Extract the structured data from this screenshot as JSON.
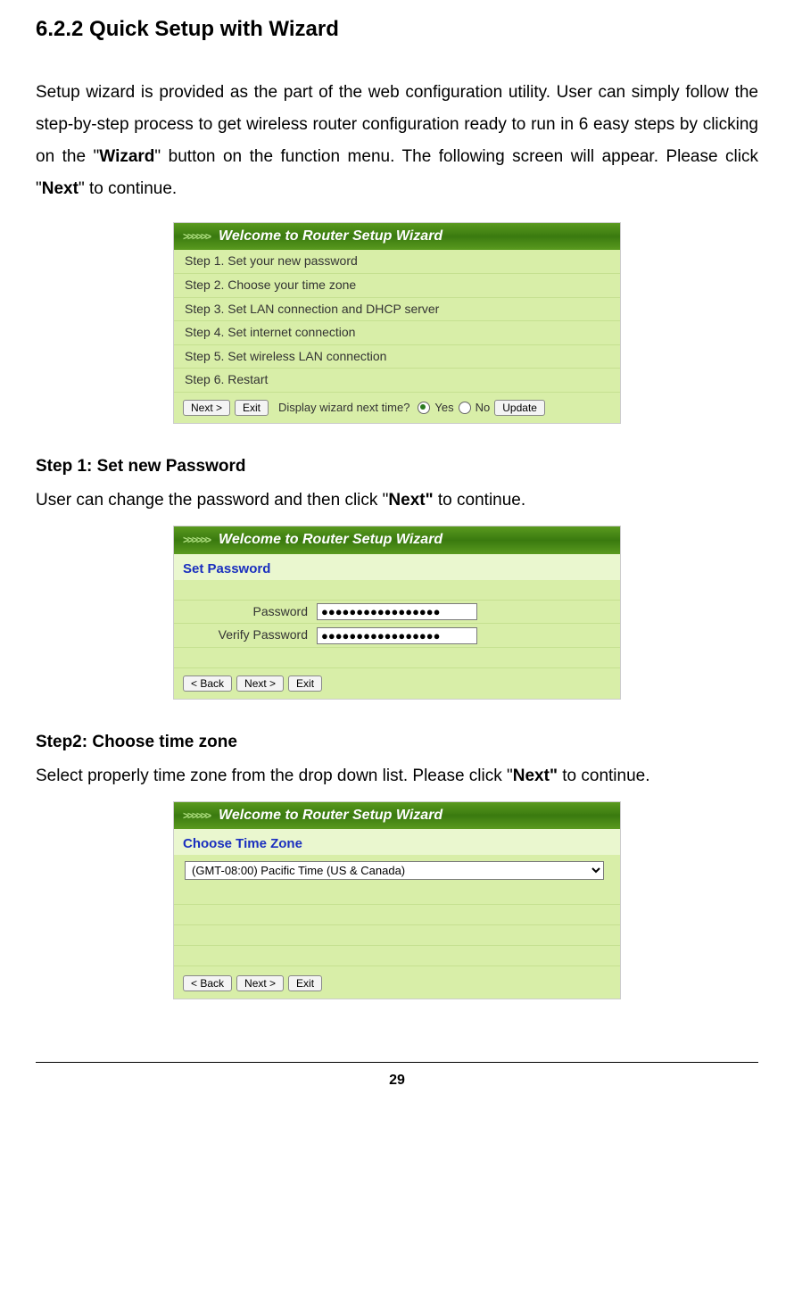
{
  "heading": "6.2.2    Quick Setup with Wizard",
  "intro_parts": {
    "p1": "Setup wizard is provided as the part of the web configuration utility. User can simply follow the step-by-step process to get wireless router configuration ready to run in 6 easy steps by clicking on the \"",
    "b1": "Wizard",
    "p2": "\" button on the function menu. The following screen will appear.    Please click \"",
    "b2": "Next",
    "p3": "\" to continue."
  },
  "wizard_header": "Welcome to Router Setup Wizard",
  "chevrons": ">>>>>>",
  "steps": [
    "Step 1. Set your new password",
    "Step 2. Choose your time zone",
    "Step 3. Set LAN connection and DHCP server",
    "Step 4. Set internet connection",
    "Step 5. Set wireless LAN connection",
    "Step 6. Restart"
  ],
  "buttons": {
    "next": "Next >",
    "exit": "Exit",
    "back": "< Back",
    "update": "Update"
  },
  "display_prompt": "Display wizard next time?",
  "yes": "Yes",
  "no": "No",
  "step1": {
    "title": "Step 1: Set new Password",
    "text_p1": "User can change the password and then click \"",
    "text_b": "Next\"",
    "text_p2": " to continue.",
    "section_label": "Set Password",
    "password_label": "Password",
    "verify_label": "Verify Password",
    "dots": "●●●●●●●●●●●●●●●●●"
  },
  "step2": {
    "title": "Step2: Choose time zone",
    "text_p1": "Select properly time zone from the drop down list.  Please click \"",
    "text_b": "Next\"",
    "text_p2": " to continue.",
    "section_label": "Choose Time Zone",
    "tz_value": "(GMT-08:00) Pacific Time (US & Canada)"
  },
  "page_number": "29"
}
